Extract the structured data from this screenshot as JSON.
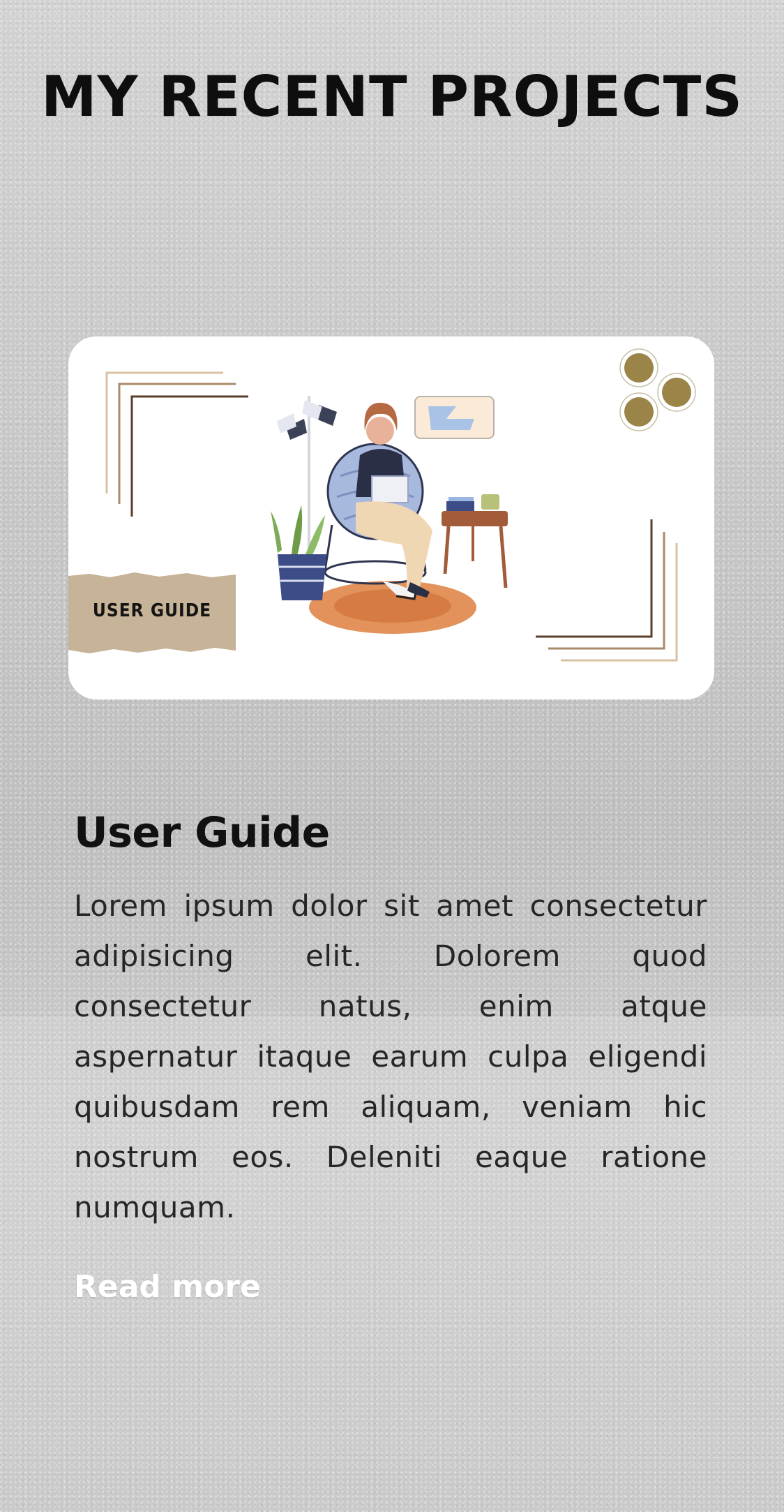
{
  "section": {
    "title": "MY RECENT PROJECTS"
  },
  "project": {
    "thumbnail_tag": "USER GUIDE",
    "title": "User Guide",
    "description": "Lorem ipsum dolor sit amet consectetur adipisicing elit. Dolorem quod consectetur natus, enim atque aspernatur itaque earum culpa eligendi quibusdam rem aliquam, veniam hic nostrum eos. Deleniti eaque ratione numquam.",
    "read_more_label": "Read more"
  },
  "colors": {
    "card_background": "#ffffff",
    "tag_paper": "#c7b397",
    "accent_brown": "#6b4a34",
    "accent_gold": "#9a8447",
    "link_text": "#ffffff"
  }
}
